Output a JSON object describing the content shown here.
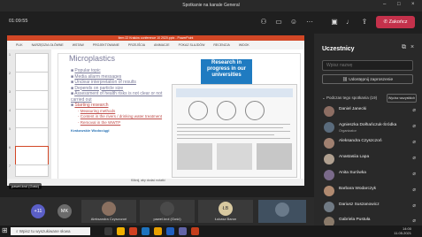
{
  "window": {
    "title": "Spotkanie na kanale General"
  },
  "call": {
    "timer": "01:09:55",
    "leave_label": "Zakończ"
  },
  "powerpoint": {
    "window_title": "Item 22 Kraków conference 10 2020.pptx - PowerPoint",
    "ribbon": [
      "PLIK",
      "NARZĘDZIA GŁÓWNE",
      "WSTAW",
      "PROJEKTOWANIE",
      "PRZEJŚCIA",
      "ANIMACJE",
      "POKAZ SLAJDÓW",
      "RECENZJA",
      "WIDOK"
    ],
    "thumb_numbers": [
      "1",
      "2",
      "3",
      "4",
      "5",
      "6",
      "7"
    ],
    "status": "Kliknij, aby dodać notatki",
    "slide": {
      "title": "Microplastics",
      "bullets": [
        {
          "text": "Popular topic"
        },
        {
          "text": "Media allarm messages"
        },
        {
          "text": "Unclear interpretation of results"
        },
        {
          "text": "Depends on particle size"
        },
        {
          "text": "Assessment of health risks is not clear or not carried out"
        },
        {
          "text": "Starting research"
        }
      ],
      "subbullets": [
        "Measuring methods",
        "Content in the rivers / drinking water treatment",
        "Removal in the WWTP"
      ],
      "logo_text": "Krakowskie Wodociągi",
      "research_box": "Research in progress in our universities"
    }
  },
  "presenter_label": "pawel.krol (Gość)",
  "video_tiles": [
    {
      "initials": "+11",
      "name": "",
      "color": "#5b5fc7"
    },
    {
      "initials": "MK",
      "name": "",
      "color": "#6b6b6b"
    },
    {
      "initials": "",
      "name": "Aleksandra Czyszczoń",
      "color": "#8a7060"
    },
    {
      "initials": "",
      "name": "pawel.krol (Gość)",
      "color": "#4a4a4a"
    },
    {
      "initials": "ŁB",
      "name": "Łukasz Baron",
      "color": "#d8c9a0"
    },
    {
      "initials": "",
      "name": "",
      "color": "#405060"
    }
  ],
  "panel": {
    "title": "Uczestnicy",
    "search_placeholder": "Wpisz nazwę",
    "share_label": "Udostępnij zaproszenie",
    "section_label": "Podczas tego spotkania (19)",
    "mute_all_label": "Wycisz wszystkich",
    "participants": [
      {
        "name": "Daniel Janecki",
        "role": ""
      },
      {
        "name": "Agnieszka Dołhańczuk-Śródka",
        "role": "Organizator"
      },
      {
        "name": "Aleksandra Czyszczoń",
        "role": ""
      },
      {
        "name": "Anastasiia Lapa",
        "role": ""
      },
      {
        "name": "Anita Surówka",
        "role": ""
      },
      {
        "name": "Barbara Wodarczyk",
        "role": ""
      },
      {
        "name": "Dariusz Suszanowicz",
        "role": ""
      },
      {
        "name": "Gabriela Pustuła",
        "role": ""
      }
    ]
  },
  "taskbar": {
    "search_placeholder": "Wpisz tu wyszukiwane słowa",
    "time": "14:00",
    "date": "11.05.2021"
  }
}
